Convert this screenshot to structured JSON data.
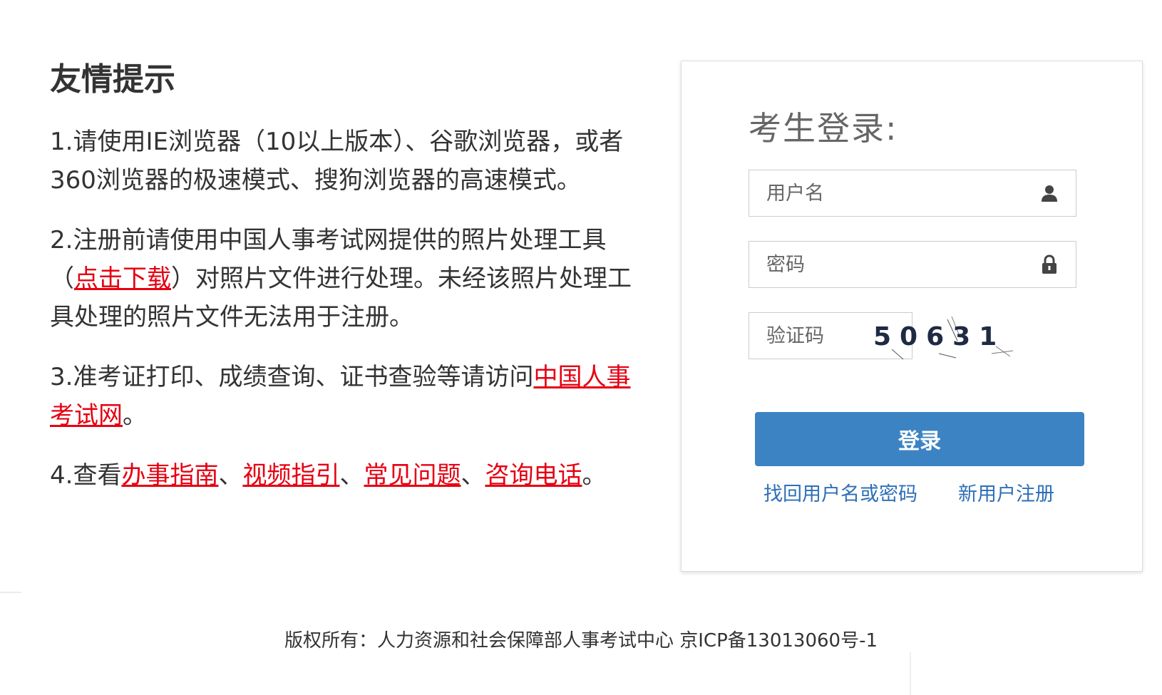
{
  "tips": {
    "title": "友情提示",
    "items": [
      {
        "text": "1.请使用IE浏览器（10以上版本）、谷歌浏览器，或者360浏览器的极速模式、搜狗浏览器的高速模式。"
      },
      {
        "prefix": "2.注册前请使用中国人事考试网提供的照片处理工具（",
        "link": "点击下载",
        "suffix": "）对照片文件进行处理。未经该照片处理工具处理的照片文件无法用于注册。"
      },
      {
        "prefix": "3.准考证打印、成绩查询、证书查验等请访问",
        "link": "中国人事考试网",
        "suffix": "。"
      },
      {
        "prefix": "4.查看",
        "links": [
          "办事指南",
          "视频指引",
          "常见问题",
          "咨询电话"
        ],
        "separator": "、",
        "suffix": "。"
      }
    ]
  },
  "login": {
    "title": "考生登录:",
    "username_placeholder": "用户名",
    "password_placeholder": "密码",
    "captcha_placeholder": "验证码",
    "captcha_text": "50631",
    "submit_label": "登录",
    "recover_link": "找回用户名或密码",
    "register_link": "新用户注册"
  },
  "icons": {
    "username": "user-icon",
    "password": "lock-icon"
  },
  "colors": {
    "link_red": "#e60012",
    "button_blue": "#3c83c4",
    "link_blue": "#2e6fb7"
  },
  "footer": {
    "text": "版权所有：人力资源和社会保障部人事考试中心 京ICP备13013060号-1"
  }
}
